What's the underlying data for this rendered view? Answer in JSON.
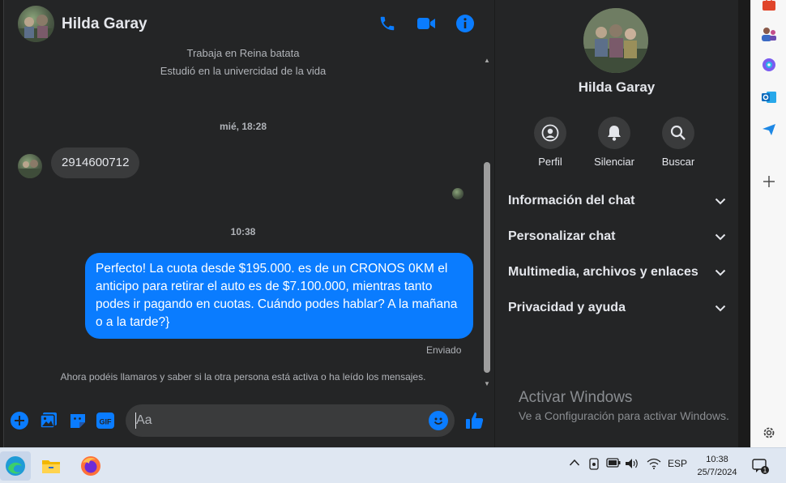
{
  "contact": {
    "name": "Hilda Garay"
  },
  "header": {
    "icons": [
      "phone-icon",
      "video-icon",
      "info-icon"
    ]
  },
  "messages": {
    "profile_lines": [
      "Trabaja en Reina batata",
      "Estudió en la univercidad de la vida"
    ],
    "timestamp_1": "mié, 18:28",
    "incoming_text": "2914600712",
    "timestamp_2": "10:38",
    "outgoing_text": "Perfecto! La cuota desde $195.000. es de un CRONOS 0KM el anticipo para retirar el auto es de $7.100.000, mientras tanto podes ir pagando en cuotas. Cuándo podes hablar? A la mañana o a la tarde?}",
    "status": "Enviado",
    "notice": "Ahora podéis llamaros y saber si la otra persona está activa o ha leído los mensajes."
  },
  "composer": {
    "placeholder": "Aa",
    "gif_label": "GIF"
  },
  "info_panel": {
    "actions": [
      {
        "label": "Perfil",
        "icon": "profile-icon"
      },
      {
        "label": "Silenciar",
        "icon": "bell-icon"
      },
      {
        "label": "Buscar",
        "icon": "search-icon"
      }
    ],
    "sections": [
      "Información del chat",
      "Personalizar chat",
      "Multimedia, archivos y enlaces",
      "Privacidad y ayuda"
    ]
  },
  "watermark": {
    "title": "Activar Windows",
    "subtitle": "Ve a Configuración para activar Windows."
  },
  "taskbar": {
    "language": "ESP",
    "time": "10:38",
    "date": "25/7/2024",
    "notification_count": "1"
  },
  "colors": {
    "accent": "#0a7cff",
    "panel": "#242526",
    "bubble_in": "#3a3b3c"
  }
}
